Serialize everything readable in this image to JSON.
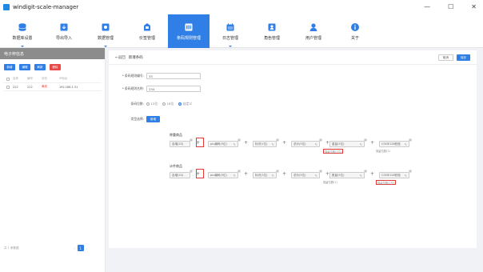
{
  "app": {
    "title": "windigit-scale-manager"
  },
  "window_controls": [
    "—",
    "☐",
    "✕"
  ],
  "toolbar": [
    {
      "label": "数据库设置",
      "icon": "database-icon",
      "caret": true
    },
    {
      "label": "导出导入",
      "icon": "import-export-icon",
      "caret": false
    },
    {
      "label": "数据管理",
      "icon": "data-manage-icon",
      "caret": true
    },
    {
      "label": "价签管理",
      "icon": "price-tag-icon",
      "caret": false
    },
    {
      "label": "条码规则管理",
      "icon": "barcode-rule-icon",
      "caret": false,
      "active": true
    },
    {
      "label": "日志管理",
      "icon": "calendar-log-icon",
      "caret": true
    },
    {
      "label": "角色管理",
      "icon": "role-icon",
      "caret": false
    },
    {
      "label": "用户管理",
      "icon": "user-icon",
      "caret": false
    },
    {
      "label": "关于",
      "icon": "info-icon",
      "caret": false
    }
  ],
  "sidebar": {
    "title": "电子秤信息",
    "buttons": [
      {
        "label": "新增",
        "color": "#2f7fe6"
      },
      {
        "label": "编辑",
        "color": "#2f7fe6"
      },
      {
        "label": "刷新",
        "color": "#2f7fe6"
      },
      {
        "label": "删除",
        "color": "#e84a4a"
      }
    ],
    "headers": [
      "名称",
      "编号",
      "状态",
      "IP地址"
    ],
    "rows": [
      {
        "name": "222",
        "code": "222",
        "status": "离线",
        "ip": "192.168.1.31"
      }
    ],
    "footer": "共 1 条数据",
    "page": "1",
    "prev": "‹",
    "next": "›"
  },
  "main": {
    "back": "←返回",
    "breadcrumb": "新增条码",
    "cancel": "取消",
    "save": "保存",
    "fields": [
      {
        "label": "* 条码规则编号:",
        "value": "33"
      },
      {
        "label": "* 条码规则名称:",
        "value": "234"
      }
    ],
    "length_label": "条码位数:",
    "length_options": [
      "13位",
      "18位",
      "自定义"
    ],
    "barcode_type_label": "类型选择:",
    "add_button": "新增",
    "section_weigh": "称重商品",
    "section_count": "计件商品",
    "weigh_chips": [
      "自增(20)",
      "plu编码(5位)",
      "标识(1位)",
      "总价(5位)",
      "重量(5位)",
      "CODE128校验"
    ],
    "count_chips": [
      "自增(20)",
      "plu编码(5位)",
      "标识(1位)",
      "总价(5位)",
      "数量(5位)",
      "CODE128校验"
    ],
    "weigh_subs": [
      "保留位数(7位)",
      "保留位数(2)"
    ],
    "count_subs": [
      "保留位数(1)",
      "保留位数(7位)"
    ]
  }
}
